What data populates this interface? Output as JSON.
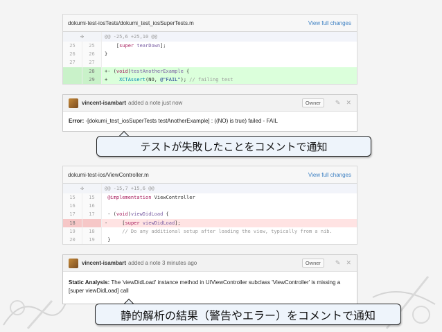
{
  "file1": {
    "path": "dokumi-test-iosTests/dokumi_test_iosSuperTests.m",
    "view_full": "View full changes",
    "expand_icon": "expand-icon",
    "rows": [
      {
        "type": "hunk",
        "old": "",
        "new": "",
        "text": "@@ -25,6 +25,10 @@"
      },
      {
        "type": "ctx",
        "old": "25",
        "new": "25",
        "text": "    [super tearDown];"
      },
      {
        "type": "ctx",
        "old": "26",
        "new": "26",
        "text": "}"
      },
      {
        "type": "ctx",
        "old": "27",
        "new": "27",
        "text": ""
      },
      {
        "type": "add",
        "old": "",
        "new": "28",
        "text": "+- (void)testAnotherExample {"
      },
      {
        "type": "add",
        "old": "",
        "new": "29",
        "text": "+    XCTAssert(NO, @\"FAIL\"); // failing test"
      }
    ]
  },
  "note1": {
    "author": "vincent-isambart",
    "action": "added a note just now",
    "owner": "Owner",
    "body_prefix": "Error:",
    "body_text": " -[dokumi_test_iosSuperTests testAnotherExample] : ((NO) is true) failed - FAIL"
  },
  "callout1": "テストが失敗したことをコメントで通知",
  "file2": {
    "path": "dokumi-test-ios/ViewController.m",
    "view_full": "View full changes",
    "rows": [
      {
        "type": "hunk",
        "old": "",
        "new": "",
        "text": "@@ -15,7 +15,6 @@"
      },
      {
        "type": "ctx",
        "old": "15",
        "new": "15",
        "text": " @implementation ViewController"
      },
      {
        "type": "ctx",
        "old": "16",
        "new": "16",
        "text": ""
      },
      {
        "type": "ctx",
        "old": "17",
        "new": "17",
        "text": " - (void)viewDidLoad {"
      },
      {
        "type": "del",
        "old": "18",
        "new": "",
        "text": "-     [super viewDidLoad];"
      },
      {
        "type": "ctx",
        "old": "19",
        "new": "18",
        "text": "      // Do any additional setup after loading the view, typically from a nib."
      },
      {
        "type": "ctx",
        "old": "20",
        "new": "19",
        "text": " }"
      }
    ]
  },
  "note2": {
    "author": "vincent-isambart",
    "action": "added a note 3 minutes ago",
    "owner": "Owner",
    "body_prefix": "Static Analysis:",
    "body_text": " The 'viewDidLoad' instance method in UIViewController subclass 'ViewController' is missing a [super viewDidLoad] call"
  },
  "callout2": "静的解析の結果（警告やエラー）をコメントで通知",
  "icons": {
    "edit": "pencil-icon",
    "close": "close-icon"
  }
}
